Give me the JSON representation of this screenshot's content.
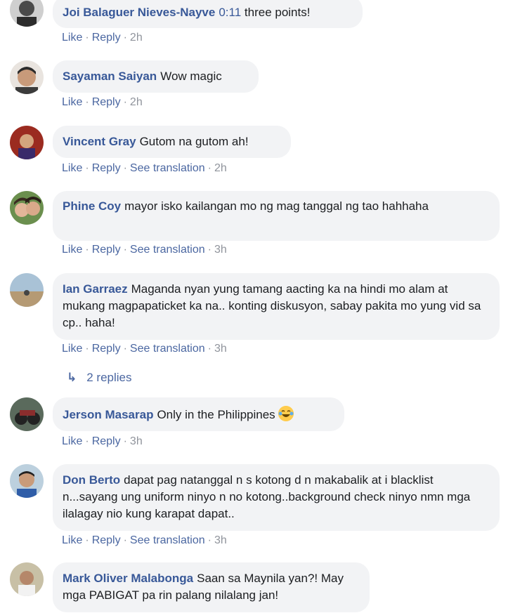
{
  "comments": [
    {
      "author": "Joi Balaguer Nieves-Nayve",
      "timestamp_link": "0:11",
      "text": " three points!",
      "actions": [
        "Like",
        "Reply"
      ],
      "time": "2h"
    },
    {
      "author": "Sayaman Saiyan",
      "text": "Wow magic",
      "actions": [
        "Like",
        "Reply"
      ],
      "time": "2h"
    },
    {
      "author": "Vincent Gray",
      "text": "Gutom na gutom ah!",
      "actions": [
        "Like",
        "Reply",
        "See translation"
      ],
      "time": "2h"
    },
    {
      "author": "Phine Coy",
      "text": "mayor isko kailangan mo ng mag tanggal ng tao hahhaha",
      "actions": [
        "Like",
        "Reply",
        "See translation"
      ],
      "time": "3h"
    },
    {
      "author": "Ian Garraez",
      "text": "Maganda nyan yung tamang aacting ka na hindi mo alam at mukang magpapaticket ka na.. konting diskusyon, sabay pakita mo yung vid sa cp.. haha!",
      "actions": [
        "Like",
        "Reply",
        "See translation"
      ],
      "time": "3h"
    },
    {
      "author": "Jerson Masarap",
      "text": "Only in the Philippines",
      "emoji": "laughing-tears-emoji",
      "actions": [
        "Like",
        "Reply"
      ],
      "time": "3h"
    },
    {
      "author": "Don Berto",
      "text": "dapat pag natanggal n s kotong d n makabalik at i blacklist n...sayang ung uniform ninyo n no kotong..background check ninyo nmn mga ilalagay nio kung karapat dapat..",
      "actions": [
        "Like",
        "Reply",
        "See translation"
      ],
      "time": "3h"
    },
    {
      "author": "Mark Oliver Malabonga",
      "text": "Saan sa Maynila yan?! May mga PABIGAT pa rin palang nilalang jan!",
      "actions": [],
      "time": ""
    }
  ],
  "replies": {
    "label": "2 replies",
    "icon": "reply-arrow-icon"
  },
  "colors": {
    "link": "#385898",
    "bubble": "#f2f3f5",
    "meta": "#90949c"
  }
}
